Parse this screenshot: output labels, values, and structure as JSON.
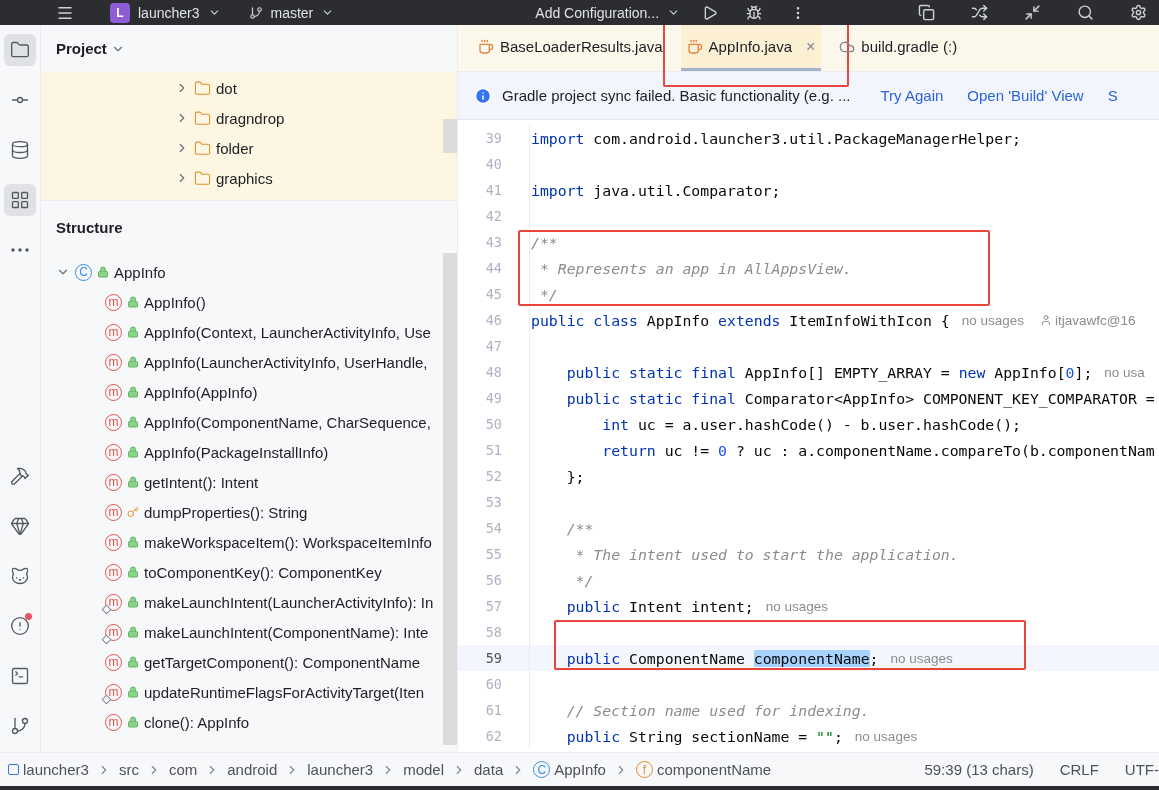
{
  "top_bar": {
    "project_badge": "L",
    "project": "launcher3",
    "branch": "master",
    "run_config": "Add Configuration..."
  },
  "tool_strip": {
    "top": [
      {
        "selected": true
      },
      {
        "selected": false
      },
      {
        "selected": false
      },
      {
        "selected": true
      },
      {
        "selected": false
      }
    ],
    "bottom": [
      {
        "badge": false
      },
      {
        "badge": false
      },
      {
        "badge": false
      },
      {
        "badge": true
      },
      {
        "badge": false
      },
      {
        "badge": false
      }
    ]
  },
  "project_panel": {
    "title": "Project",
    "items": [
      {
        "label": "dot",
        "expanded": false
      },
      {
        "label": "dragndrop",
        "expanded": false
      },
      {
        "label": "folder",
        "expanded": false
      },
      {
        "label": "graphics",
        "expanded": false
      }
    ]
  },
  "structure_panel": {
    "title": "Structure",
    "tree": [
      {
        "label": "AppInfo",
        "glyph": "C",
        "expanded": true,
        "children": [
          {
            "glyph": "m",
            "label": "AppInfo()",
            "kind": "public",
            "overrides": false
          },
          {
            "glyph": "m",
            "label": "AppInfo(Context, LauncherActivityInfo, Use",
            "kind": "public",
            "overrides": false
          },
          {
            "glyph": "m",
            "label": "AppInfo(LauncherActivityInfo, UserHandle,",
            "kind": "public",
            "overrides": false
          },
          {
            "glyph": "m",
            "label": "AppInfo(AppInfo)",
            "kind": "public",
            "overrides": false
          },
          {
            "glyph": "m",
            "label": "AppInfo(ComponentName, CharSequence,",
            "kind": "public",
            "overrides": false
          },
          {
            "glyph": "m",
            "label": "AppInfo(PackageInstallInfo)",
            "kind": "public",
            "overrides": false
          },
          {
            "glyph": "m",
            "label": "getIntent(): Intent",
            "kind": "public",
            "overrides": false
          },
          {
            "glyph": "m",
            "label": "dumpProperties(): String",
            "kind": "protected",
            "overrides": false
          },
          {
            "glyph": "m",
            "label": "makeWorkspaceItem(): WorkspaceItemInfo",
            "kind": "public",
            "overrides": false
          },
          {
            "glyph": "m",
            "label": "toComponentKey(): ComponentKey",
            "kind": "public",
            "overrides": false
          },
          {
            "glyph": "m",
            "label": "makeLaunchIntent(LauncherActivityInfo): In",
            "kind": "public",
            "overrides": true
          },
          {
            "glyph": "m",
            "label": "makeLaunchIntent(ComponentName): Inte",
            "kind": "public",
            "overrides": true
          },
          {
            "glyph": "m",
            "label": "getTargetComponent(): ComponentName",
            "kind": "public",
            "overrides": false
          },
          {
            "glyph": "m",
            "label": "updateRuntimeFlagsForActivityTarget(Iten",
            "kind": "public",
            "overrides": true
          },
          {
            "glyph": "m",
            "label": "clone(): AppInfo",
            "kind": "public",
            "overrides": false
          }
        ]
      }
    ]
  },
  "tabs": [
    {
      "label": "BaseLoaderResults.java",
      "kind": "java",
      "selected": false,
      "closable": false,
      "framed": false
    },
    {
      "label": "AppInfo.java",
      "kind": "java",
      "selected": true,
      "closable": true,
      "framed": true,
      "close_glyph": "×"
    },
    {
      "label": "build.gradle (:)",
      "kind": "gradle",
      "selected": false,
      "closable": false,
      "framed": false
    }
  ],
  "banner": {
    "message": "Gradle project sync failed. Basic functionality (e.g. ...",
    "links": [
      "Try Again",
      "Open 'Build' View",
      "S"
    ]
  },
  "code": [
    {
      "number": "39",
      "current": false,
      "framed": false,
      "tokens": [
        {
          "kind": "keyword",
          "text": "import"
        },
        {
          "kind": "plain",
          "text": " com.android.launcher3.util.PackageManagerHelper;"
        }
      ]
    },
    {
      "number": "40",
      "current": false,
      "framed": false
    },
    {
      "number": "41",
      "current": false,
      "framed": false,
      "tokens": [
        {
          "kind": "keyword",
          "text": "import"
        },
        {
          "kind": "plain",
          "text": " java.util.Comparator;"
        }
      ]
    },
    {
      "number": "42",
      "current": false,
      "framed": false
    },
    {
      "number": "43",
      "current": false,
      "framed": true,
      "tokens": [
        {
          "kind": "comment",
          "text": "/**"
        }
      ]
    },
    {
      "number": "44",
      "current": false,
      "framed": true,
      "tokens": [
        {
          "kind": "comment",
          "text": " * Represents an app in AllAppsView."
        }
      ]
    },
    {
      "number": "45",
      "current": false,
      "framed": true,
      "tokens": [
        {
          "kind": "comment",
          "text": " */"
        }
      ]
    },
    {
      "number": "46",
      "current": false,
      "framed": false,
      "tokens": [
        {
          "kind": "keyword",
          "text": "public"
        },
        {
          "kind": "keyword",
          "text": " class"
        },
        {
          "kind": "plain",
          "text": " AppInfo "
        },
        {
          "kind": "keyword",
          "text": "extends"
        },
        {
          "kind": "plain",
          "text": " ItemInfoWithIcon {"
        },
        {
          "kind": "hint",
          "text": "no usages"
        },
        {
          "kind": "author",
          "text": "itjavawfc@16"
        }
      ]
    },
    {
      "number": "47",
      "current": false,
      "framed": false
    },
    {
      "number": "48",
      "current": false,
      "framed": false,
      "tokens": [
        {
          "kind": "keyword",
          "text": "    public static final"
        },
        {
          "kind": "plain",
          "text": " AppInfo[] EMPTY_ARRAY = "
        },
        {
          "kind": "keyword",
          "text": "new"
        },
        {
          "kind": "plain",
          "text": " AppInfo["
        },
        {
          "kind": "number",
          "text": "0"
        },
        {
          "kind": "plain",
          "text": "];"
        },
        {
          "kind": "hint",
          "text": "no usa"
        }
      ]
    },
    {
      "number": "49",
      "current": false,
      "framed": false,
      "tokens": [
        {
          "kind": "keyword",
          "text": "    public static final"
        },
        {
          "kind": "plain",
          "text": " Comparator<AppInfo> COMPONENT_KEY_COMPARATOR ="
        }
      ]
    },
    {
      "number": "50",
      "current": false,
      "framed": false,
      "tokens": [
        {
          "kind": "keyword",
          "text": "        int"
        },
        {
          "kind": "plain",
          "text": " uc = a.user.hashCode() - b.user.hashCode();"
        }
      ]
    },
    {
      "number": "51",
      "current": false,
      "framed": false,
      "tokens": [
        {
          "kind": "keyword",
          "text": "        return"
        },
        {
          "kind": "plain",
          "text": " uc != "
        },
        {
          "kind": "number",
          "text": "0"
        },
        {
          "kind": "plain",
          "text": " ? uc : a.componentName.compareTo(b.componentNam"
        }
      ]
    },
    {
      "number": "52",
      "current": false,
      "framed": false,
      "tokens": [
        {
          "kind": "plain",
          "text": "    };"
        }
      ]
    },
    {
      "number": "53",
      "current": false,
      "framed": false
    },
    {
      "number": "54",
      "current": false,
      "framed": false,
      "tokens": [
        {
          "kind": "comment",
          "text": "    /**"
        }
      ]
    },
    {
      "number": "55",
      "current": false,
      "framed": false,
      "tokens": [
        {
          "kind": "comment",
          "text": "     * The intent used to start the application."
        }
      ]
    },
    {
      "number": "56",
      "current": false,
      "framed": false,
      "tokens": [
        {
          "kind": "comment",
          "text": "     */"
        }
      ]
    },
    {
      "number": "57",
      "current": false,
      "framed": false,
      "tokens": [
        {
          "kind": "keyword",
          "text": "    public"
        },
        {
          "kind": "plain",
          "text": " Intent intent;"
        },
        {
          "kind": "hint",
          "text": "no usages"
        }
      ]
    },
    {
      "number": "58",
      "current": false,
      "framed": true
    },
    {
      "number": "59",
      "current": true,
      "framed": true,
      "tokens": [
        {
          "kind": "keyword",
          "text": "    public"
        },
        {
          "kind": "plain",
          "text": " ComponentName "
        },
        {
          "kind": "selection",
          "text": "componentName"
        },
        {
          "kind": "plain",
          "text": ";"
        },
        {
          "kind": "hint",
          "text": "no usages"
        }
      ]
    },
    {
      "number": "60",
      "current": false,
      "framed": false
    },
    {
      "number": "61",
      "current": false,
      "framed": false,
      "tokens": [
        {
          "kind": "comment",
          "text": "    // Section name used for indexing."
        }
      ]
    },
    {
      "number": "62",
      "current": false,
      "framed": false,
      "tokens": [
        {
          "kind": "keyword",
          "text": "    public"
        },
        {
          "kind": "plain",
          "text": " String sectionName = "
        },
        {
          "kind": "string",
          "text": "\"\""
        },
        {
          "kind": "plain",
          "text": ";"
        },
        {
          "kind": "hint",
          "text": "no usages"
        }
      ]
    }
  ],
  "status_bar": {
    "breadcrumbs": [
      {
        "kind": "module",
        "label": "launcher3"
      },
      {
        "kind": "plain",
        "label": "src"
      },
      {
        "kind": "plain",
        "label": "com"
      },
      {
        "kind": "plain",
        "label": "android"
      },
      {
        "kind": "plain",
        "label": "launcher3"
      },
      {
        "kind": "plain",
        "label": "model"
      },
      {
        "kind": "plain",
        "label": "data"
      },
      {
        "kind": "class",
        "label": "AppInfo",
        "glyph": "C"
      },
      {
        "kind": "field",
        "label": "componentName",
        "glyph": "f"
      }
    ],
    "position": "59:39 (13 chars)",
    "line_ending": "CRLF",
    "encoding": "UTF-"
  }
}
